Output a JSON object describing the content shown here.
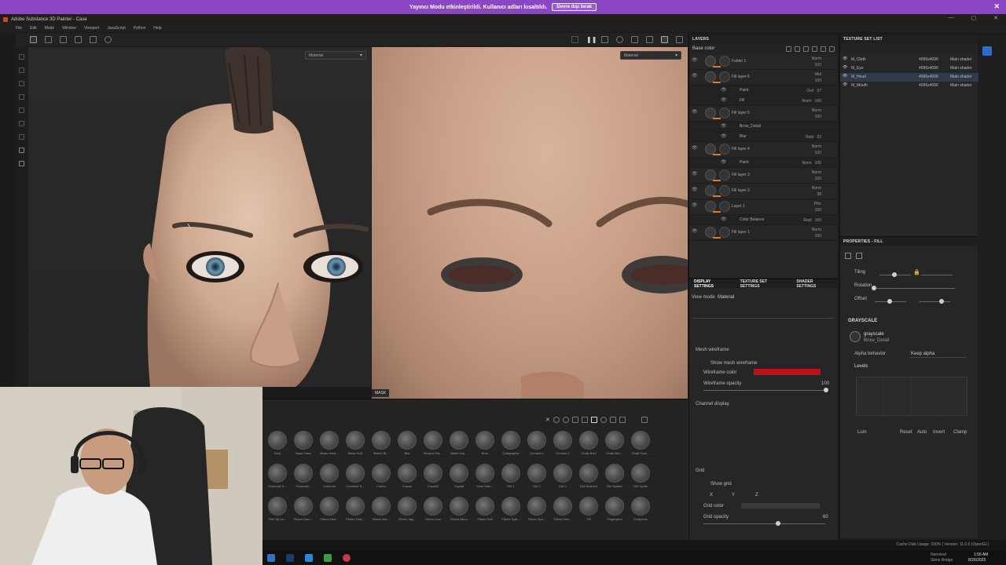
{
  "banner": {
    "text": "Yayıncı Modu etkinleştirildi. Kullanıcı adları kısaltıldı.",
    "button": "Devre dışı bırak"
  },
  "window": {
    "title": "Adobe Substance 3D Painter - Case"
  },
  "menu": [
    "File",
    "Edit",
    "Mode",
    "Window",
    "Viewport",
    "JavaScript",
    "Python",
    "Help"
  ],
  "viewport": {
    "left_mode": "Material",
    "right_mode": "Material",
    "mask_label": "MASK"
  },
  "layers": {
    "title": "LAYERS",
    "filter": "Base color",
    "rows": [
      {
        "name": "Folder 1",
        "blend": "Norm",
        "opacity": "100",
        "sub": false
      },
      {
        "name": "Fill layer 6",
        "blend": "Mul",
        "opacity": "100",
        "sub": false
      },
      {
        "name": "Paint",
        "blend": "Ovrl",
        "opacity": "57",
        "sub": true
      },
      {
        "name": "Fill",
        "blend": "Norm",
        "opacity": "100",
        "sub": true
      },
      {
        "name": "Fill layer 5",
        "blend": "Norm",
        "opacity": "100",
        "sub": false
      },
      {
        "name": "Brow_Detail",
        "blend": "",
        "opacity": "",
        "sub": true
      },
      {
        "name": "Blur",
        "blend": "Repl",
        "opacity": "62",
        "sub": true
      },
      {
        "name": "Fill layer 4",
        "blend": "Norm",
        "opacity": "100",
        "sub": false
      },
      {
        "name": "Paint",
        "blend": "Norm",
        "opacity": "100",
        "sub": true
      },
      {
        "name": "Fill layer 3",
        "blend": "Norm",
        "opacity": "100",
        "sub": false
      },
      {
        "name": "Fill layer 2",
        "blend": "Norm",
        "opacity": "38",
        "sub": false
      },
      {
        "name": "Layer 1",
        "blend": "Pthr",
        "opacity": "100",
        "sub": false
      },
      {
        "name": "Color Balance",
        "blend": "Repl",
        "opacity": "100",
        "sub": true
      },
      {
        "name": "Fill layer 1",
        "blend": "Norm",
        "opacity": "100",
        "sub": false
      }
    ]
  },
  "texture_sets": {
    "title": "TEXTURE SET LIST",
    "rows": [
      {
        "name": "M_Cloth",
        "res": "4096x4096",
        "shader": "Main shader"
      },
      {
        "name": "M_Eye",
        "res": "4096x4096",
        "shader": "Main shader"
      },
      {
        "name": "M_Head",
        "res": "4096x4096",
        "shader": "Main shader"
      },
      {
        "name": "M_Mouth",
        "res": "4096x4096",
        "shader": "Main shader"
      }
    ]
  },
  "properties": {
    "title": "PROPERTIES - FILL",
    "tiling": "Tiling",
    "rotation": "Rotation",
    "offset": "Offset",
    "grayscale_section": "GRAYSCALE",
    "grayscale_name": "grayscale",
    "grayscale_sub": "Brow_Detail",
    "alpha_behavior": "Alpha behavior",
    "alpha_value": "Keep alpha",
    "levels": "Levels",
    "lum": "Lum",
    "reset": "Reset",
    "auto": "Auto",
    "invert": "Invert",
    "clamp": "Clamp"
  },
  "display": {
    "tabs": [
      "DISPLAY SETTINGS",
      "TEXTURE SET SETTINGS",
      "SHADER SETTINGS"
    ],
    "view_mode_label": "View mode",
    "view_mode": "Material",
    "mesh_wireframe": "Mesh wireframe",
    "show_wireframe": "Show mesh wireframe",
    "wireframe_color": "Wireframe color",
    "wireframe_opacity": "Wireframe opacity",
    "wireframe_opacity_val": "100",
    "channel_display": "Channel display",
    "grid": "Grid",
    "show_grid": "Show grid",
    "grid_x": "X",
    "grid_y": "Y",
    "grid_z": "Z",
    "grid_color": "Grid color",
    "grid_opacity": "Grid opacity",
    "grid_opacity_val": "60",
    "wire_color_hex": "#c0101c"
  },
  "shelf": {
    "brushes": [
      "Dust",
      "Basic Hard",
      "Basic Hard...",
      "Basic Soft",
      "Bokeh Bl...",
      "Blur",
      "Broken Gla...",
      "Bullet Imp...",
      "Burn",
      "Calligraphic",
      "Cement 1",
      "Cement 2",
      "Chalk Bold",
      "Chalk Bun...",
      "Chalk Spre...",
      "Charcoal S...",
      "Charcoal...",
      "Concrete",
      "Concrete S...",
      "Cotton",
      "Cracks",
      "Cracks2",
      "Crystal",
      "Dark Hatc...",
      "Dirt 1",
      "Dirt 2",
      "Dirt 3",
      "Dirt Brushed",
      "Dirt Splash",
      "Dirt Spots",
      "Felt Tip La...",
      "Fibers Dam...",
      "Fibers Den...",
      "Fibers Feat...",
      "Fibers Inte...",
      "Fibers Jag...",
      "Fibers Line",
      "Fibers Micro",
      "Fibers Soft",
      "Fibers Spik...",
      "Fibers Spo...",
      "Fibers Vert...",
      "Fill",
      "Fingerprint",
      "Footprints"
    ]
  },
  "status": {
    "cache": "Cache Disk Usage: 100% | Version: 11.0.0 (OpenGL)",
    "time": "1:56 AM",
    "date": "8/26/2025",
    "app1": "Nanoleaf",
    "app2": "Slime Bridge"
  }
}
